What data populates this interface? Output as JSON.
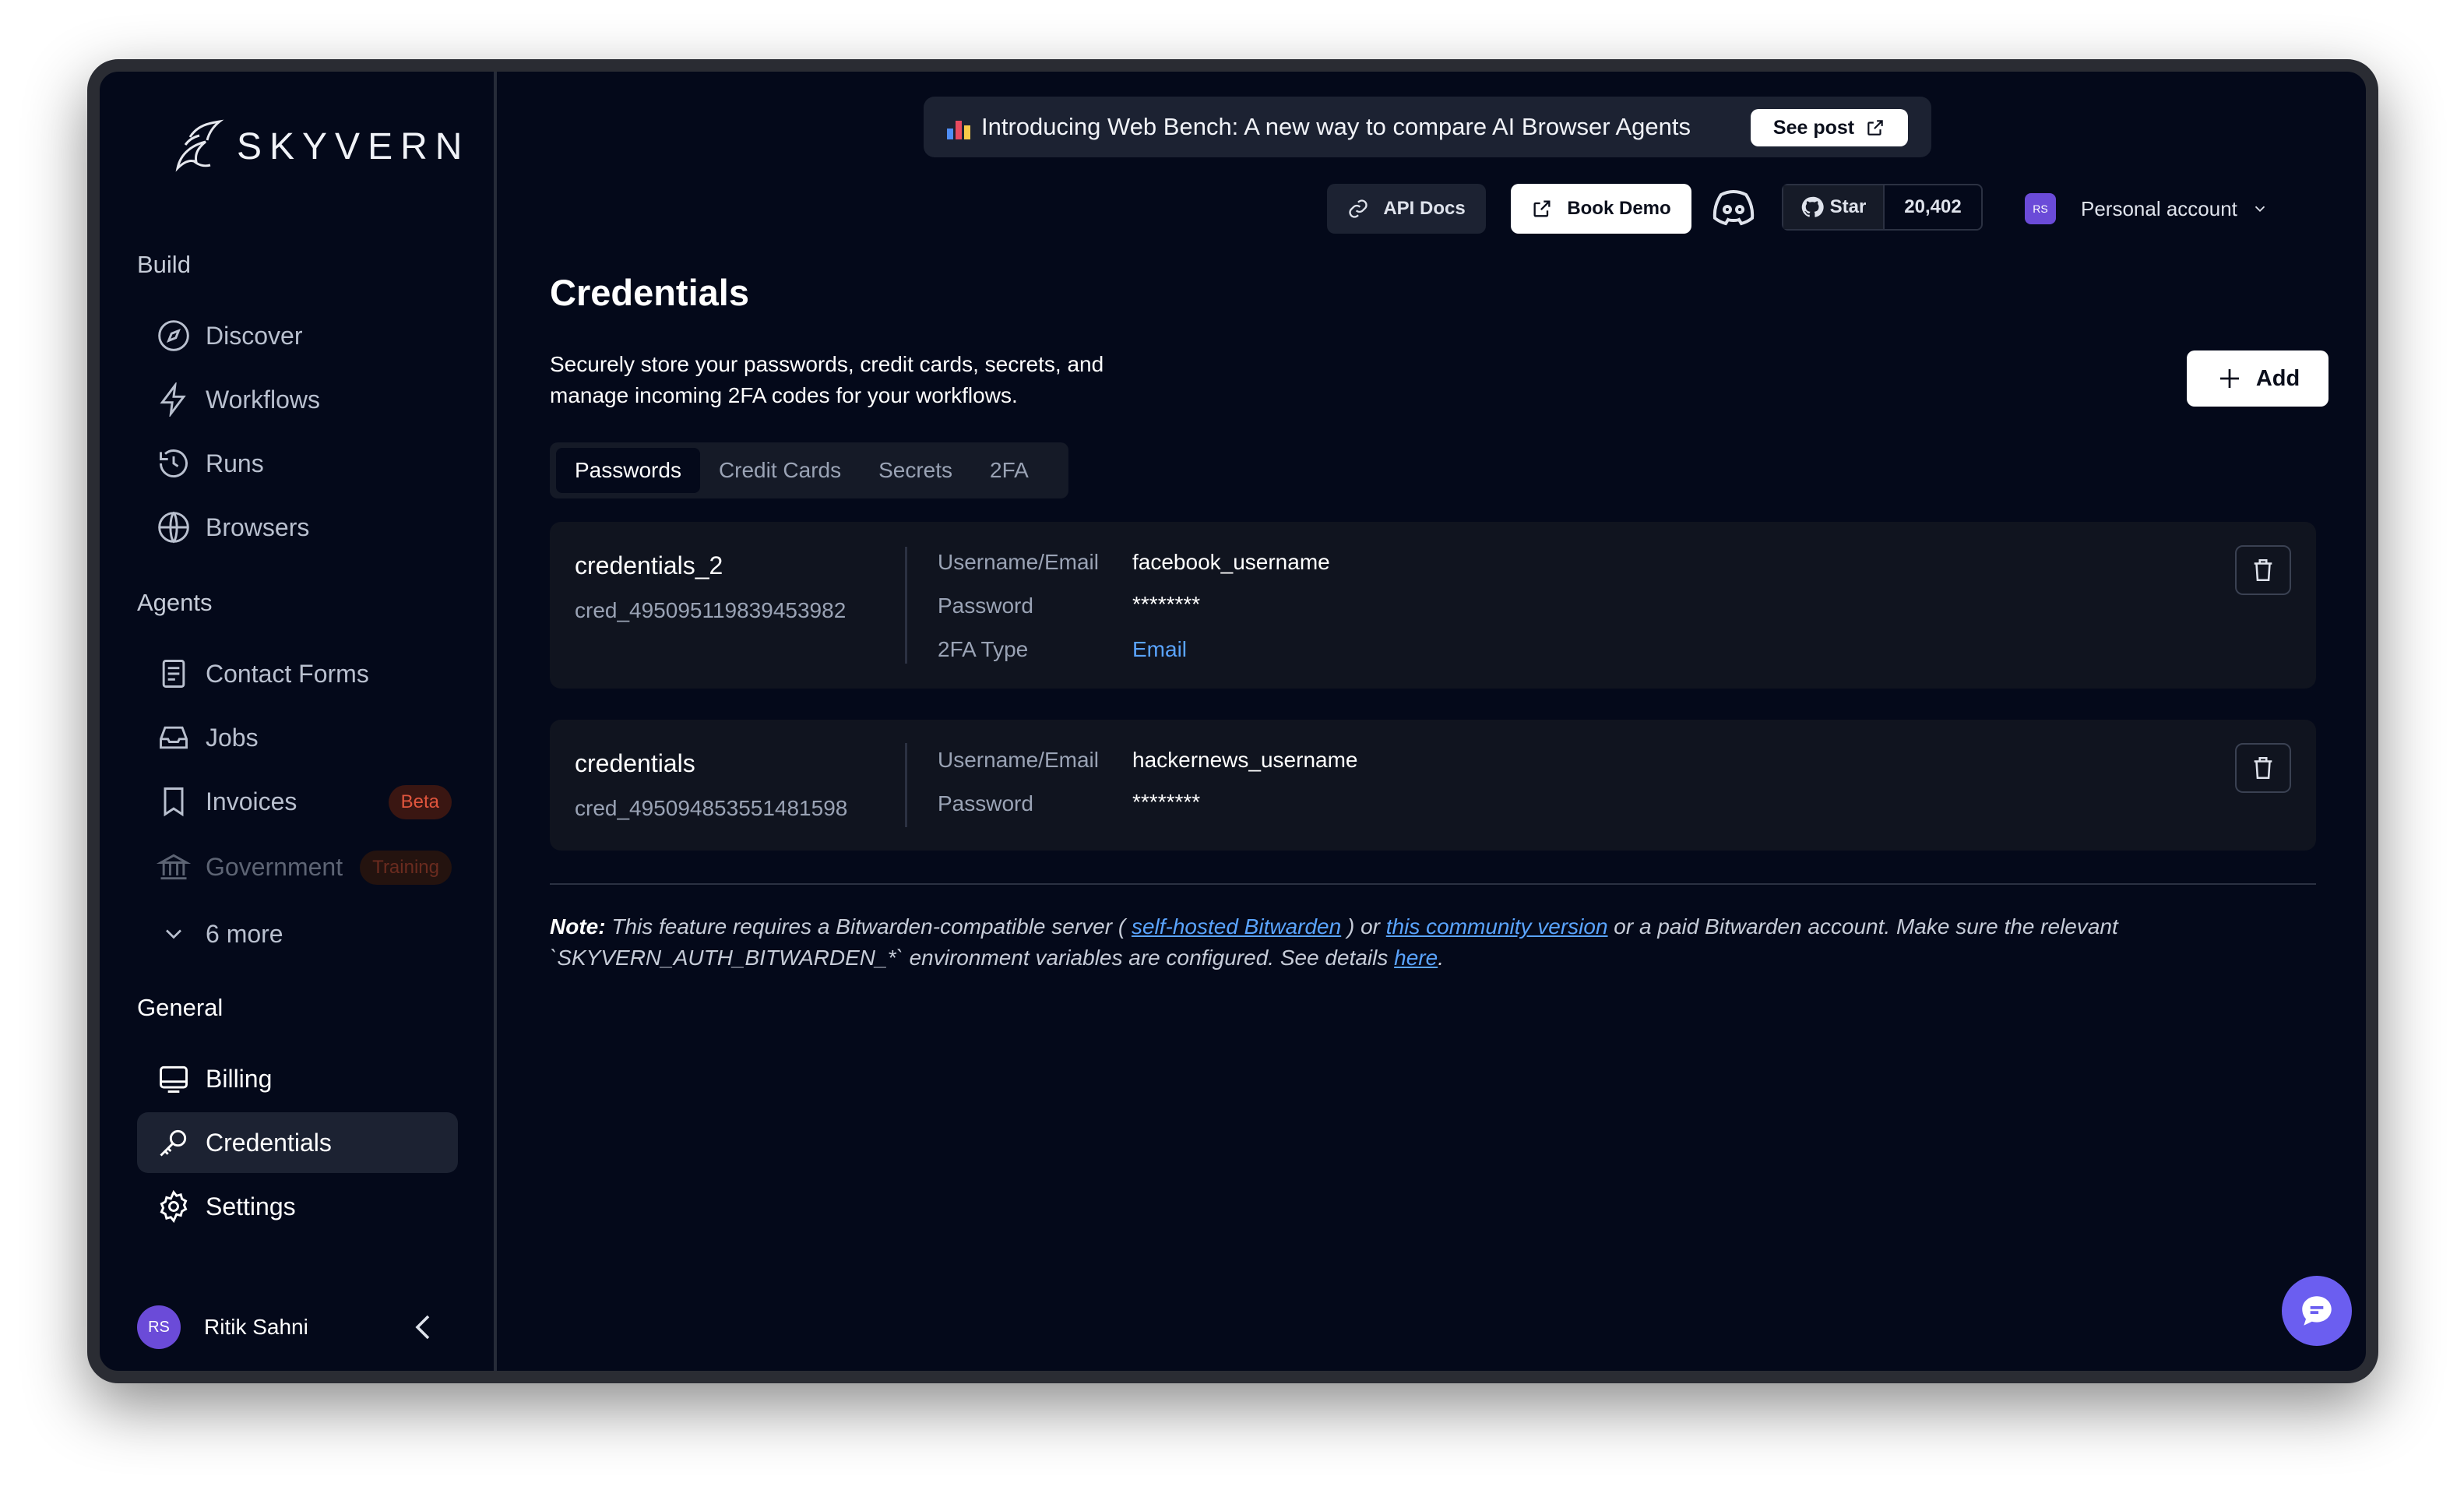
{
  "brand": {
    "name": "SKYVERN"
  },
  "sidebar": {
    "sections": [
      {
        "title": "Build"
      },
      {
        "title": "Agents"
      },
      {
        "title": "General"
      }
    ],
    "build_items": [
      {
        "label": "Discover",
        "icon": "compass-icon"
      },
      {
        "label": "Workflows",
        "icon": "lightning-icon"
      },
      {
        "label": "Runs",
        "icon": "history-icon"
      },
      {
        "label": "Browsers",
        "icon": "globe-icon"
      }
    ],
    "agent_items": [
      {
        "label": "Contact Forms",
        "icon": "document-icon"
      },
      {
        "label": "Jobs",
        "icon": "inbox-icon"
      },
      {
        "label": "Invoices",
        "icon": "bookmark-icon",
        "badge": "Beta"
      },
      {
        "label": "Government",
        "icon": "bank-icon",
        "badge": "Training"
      },
      {
        "label": "6 more",
        "icon": "chevron-down-icon"
      }
    ],
    "general_items": [
      {
        "label": "Billing",
        "icon": "billing-icon"
      },
      {
        "label": "Credentials",
        "icon": "key-icon",
        "active": true
      },
      {
        "label": "Settings",
        "icon": "gear-icon"
      }
    ],
    "user": {
      "initials": "RS",
      "name": "Ritik Sahni"
    }
  },
  "banner": {
    "text": "Introducing Web Bench: A new way to compare AI Browser Agents",
    "cta": "See post"
  },
  "header": {
    "api_docs": "API Docs",
    "book_demo": "Book Demo",
    "github_star": "Star",
    "github_count": "20,402",
    "account_initials": "RS",
    "account_label": "Personal account"
  },
  "page": {
    "title": "Credentials",
    "description": "Securely store your passwords, credit cards, secrets, and manage incoming 2FA codes for your workflows.",
    "add_label": "Add",
    "tabs": [
      {
        "label": "Passwords",
        "active": true
      },
      {
        "label": "Credit Cards"
      },
      {
        "label": "Secrets"
      },
      {
        "label": "2FA"
      }
    ]
  },
  "credentials": [
    {
      "name": "credentials_2",
      "id": "cred_495095119839453982",
      "fields": [
        {
          "label": "Username/Email",
          "value": "facebook_username"
        },
        {
          "label": "Password",
          "value": "********"
        },
        {
          "label": "2FA Type",
          "value": "Email"
        }
      ]
    },
    {
      "name": "credentials",
      "id": "cred_495094853551481598",
      "fields": [
        {
          "label": "Username/Email",
          "value": "hackernews_username"
        },
        {
          "label": "Password",
          "value": "********"
        }
      ]
    }
  ],
  "note": {
    "label": "Note:",
    "part1": " This feature requires a Bitwarden-compatible server ( ",
    "link1": "self-hosted Bitwarden",
    "part2": " ) or ",
    "link2": "this community version",
    "part3": " or a paid Bitwarden account. Make sure the relevant `SKYVERN_AUTH_BITWARDEN_*` environment variables are configured. See details ",
    "link3": "here",
    "part4": "."
  },
  "colors": {
    "background": "#04091a",
    "surface": "#10141f",
    "accent": "#6b5ef0",
    "link": "#5aa4ff",
    "beta": "#e0553d"
  }
}
